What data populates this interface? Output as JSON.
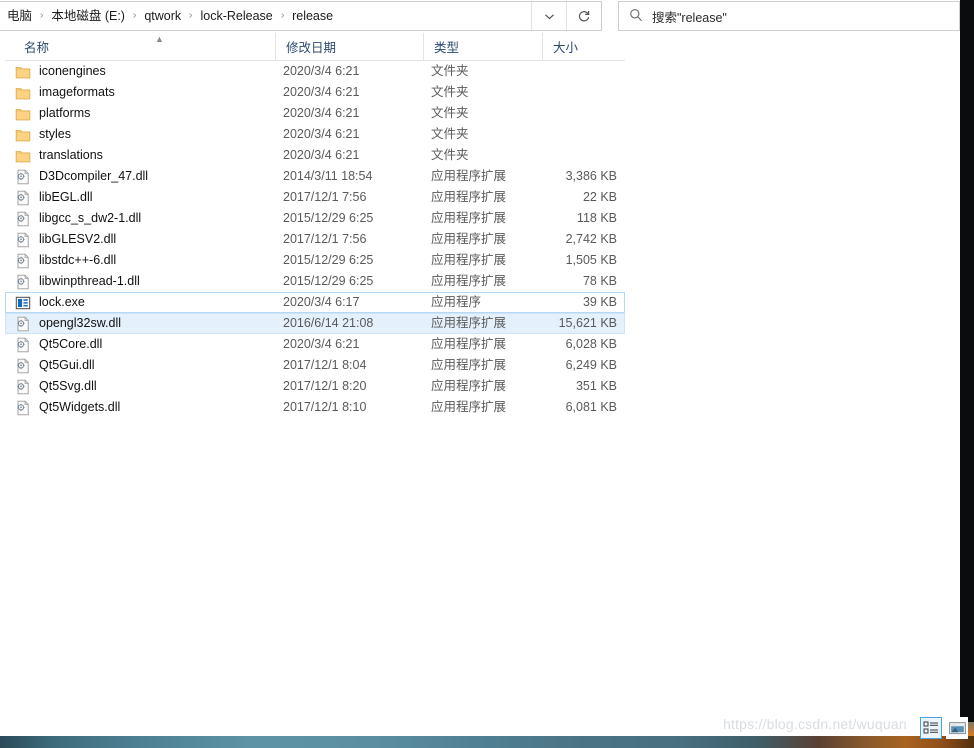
{
  "window": {
    "title": "release"
  },
  "address": {
    "breadcrumbs": [
      {
        "label": "电脑",
        "clipped": true
      },
      {
        "label": "本地磁盘 (E:)"
      },
      {
        "label": "qtwork"
      },
      {
        "label": "lock-Release"
      },
      {
        "label": "release"
      }
    ],
    "separator": "›",
    "dropdown_icon": "chevron-down-icon",
    "refresh_icon": "refresh-icon"
  },
  "search": {
    "icon": "search-icon",
    "placeholder": "搜索\"release\"",
    "value": ""
  },
  "columns": [
    {
      "key": "name",
      "label": "名称",
      "sorted": "asc"
    },
    {
      "key": "date",
      "label": "修改日期"
    },
    {
      "key": "type",
      "label": "类型"
    },
    {
      "key": "size",
      "label": "大小"
    }
  ],
  "files": [
    {
      "name": "iconengines",
      "date": "2020/3/4 6:21",
      "type": "文件夹",
      "size": "",
      "icon": "folder-icon",
      "state": "normal"
    },
    {
      "name": "imageformats",
      "date": "2020/3/4 6:21",
      "type": "文件夹",
      "size": "",
      "icon": "folder-icon",
      "state": "normal"
    },
    {
      "name": "platforms",
      "date": "2020/3/4 6:21",
      "type": "文件夹",
      "size": "",
      "icon": "folder-icon",
      "state": "normal"
    },
    {
      "name": "styles",
      "date": "2020/3/4 6:21",
      "type": "文件夹",
      "size": "",
      "icon": "folder-icon",
      "state": "normal"
    },
    {
      "name": "translations",
      "date": "2020/3/4 6:21",
      "type": "文件夹",
      "size": "",
      "icon": "folder-icon",
      "state": "normal"
    },
    {
      "name": "D3Dcompiler_47.dll",
      "date": "2014/3/11 18:54",
      "type": "应用程序扩展",
      "size": "3,386 KB",
      "icon": "dll-icon",
      "state": "normal"
    },
    {
      "name": "libEGL.dll",
      "date": "2017/12/1 7:56",
      "type": "应用程序扩展",
      "size": "22 KB",
      "icon": "dll-icon",
      "state": "normal"
    },
    {
      "name": "libgcc_s_dw2-1.dll",
      "date": "2015/12/29 6:25",
      "type": "应用程序扩展",
      "size": "118 KB",
      "icon": "dll-icon",
      "state": "normal"
    },
    {
      "name": "libGLESV2.dll",
      "date": "2017/12/1 7:56",
      "type": "应用程序扩展",
      "size": "2,742 KB",
      "icon": "dll-icon",
      "state": "normal"
    },
    {
      "name": "libstdc++-6.dll",
      "date": "2015/12/29 6:25",
      "type": "应用程序扩展",
      "size": "1,505 KB",
      "icon": "dll-icon",
      "state": "normal"
    },
    {
      "name": "libwinpthread-1.dll",
      "date": "2015/12/29 6:25",
      "type": "应用程序扩展",
      "size": "78 KB",
      "icon": "dll-icon",
      "state": "normal"
    },
    {
      "name": "lock.exe",
      "date": "2020/3/4 6:17",
      "type": "应用程序",
      "size": "39 KB",
      "icon": "exe-icon",
      "state": "focused"
    },
    {
      "name": "opengl32sw.dll",
      "date": "2016/6/14 21:08",
      "type": "应用程序扩展",
      "size": "15,621 KB",
      "icon": "dll-icon",
      "state": "selected"
    },
    {
      "name": "Qt5Core.dll",
      "date": "2020/3/4 6:21",
      "type": "应用程序扩展",
      "size": "6,028 KB",
      "icon": "dll-icon",
      "state": "normal"
    },
    {
      "name": "Qt5Gui.dll",
      "date": "2017/12/1 8:04",
      "type": "应用程序扩展",
      "size": "6,249 KB",
      "icon": "dll-icon",
      "state": "normal"
    },
    {
      "name": "Qt5Svg.dll",
      "date": "2017/12/1 8:20",
      "type": "应用程序扩展",
      "size": "351 KB",
      "icon": "dll-icon",
      "state": "normal"
    },
    {
      "name": "Qt5Widgets.dll",
      "date": "2017/12/1 8:10",
      "type": "应用程序扩展",
      "size": "6,081 KB",
      "icon": "dll-icon",
      "state": "normal"
    }
  ],
  "statusbar": {
    "watermark": "https://blog.csdn.net/wuquan",
    "view_buttons": [
      {
        "name": "details-view-button",
        "icon": "details-view-icon",
        "active": true
      },
      {
        "name": "large-icons-view-button",
        "icon": "large-icons-view-icon",
        "active": false
      }
    ]
  },
  "colors": {
    "selection_fill": "#e4f0fb",
    "focus_border": "#b5d9f5",
    "header_text": "#2b4a6f",
    "folder_icon": "#ffd784",
    "exe_icon": "#1a69b8",
    "watermark": "#d8dde2",
    "accent": "#4aa3e0"
  }
}
